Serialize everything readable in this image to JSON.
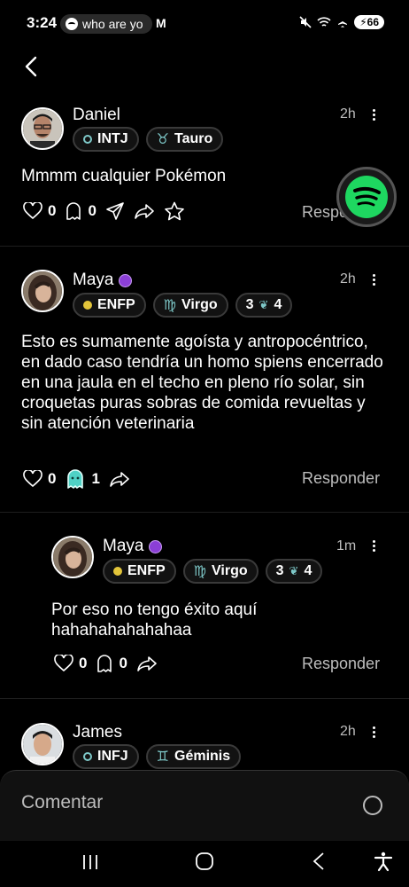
{
  "status": {
    "time": "3:24",
    "media_pill": "who are yo",
    "mail_glyph": "M",
    "battery": "66"
  },
  "comments": [
    {
      "name": "Daniel",
      "time": "2h",
      "badges": [
        {
          "label": "INTJ",
          "dot": "#7ec8c8"
        },
        {
          "label": "Tauro",
          "sign": "♉"
        }
      ],
      "text": "Mmmm cualquier Pokémon",
      "likes": "0",
      "ghosts": "0",
      "reply": "Responder"
    },
    {
      "name": "Maya",
      "time": "2h",
      "badges": [
        {
          "label": "ENFP",
          "dot": "#e3c53a"
        },
        {
          "label": "Virgo",
          "sign": "♍"
        },
        {
          "label": "3",
          "extra": "4"
        }
      ],
      "text": "Esto es sumamente agoísta y antropocéntrico, en dado caso tendría un homo spiens encerrado en una jaula en el techo en pleno  río solar, sin croquetas puras sobras de comida revueltas y sin atención veterinaria",
      "likes": "0",
      "ghosts": "1",
      "reply": "Responder"
    },
    {
      "name": "Maya",
      "time": "1m",
      "badges": [
        {
          "label": "ENFP",
          "dot": "#e3c53a"
        },
        {
          "label": "Virgo",
          "sign": "♍"
        },
        {
          "label": "3",
          "extra": "4"
        }
      ],
      "text": "Por eso no tengo éxito aquí hahahahahahahaa",
      "likes": "0",
      "ghosts": "0",
      "reply": "Responder"
    },
    {
      "name": "James",
      "time": "2h",
      "badges": [
        {
          "label": "INFJ",
          "dot": "#7ec8c8"
        },
        {
          "label": "Géminis",
          "sign": "♊"
        }
      ]
    }
  ],
  "composer": {
    "placeholder": "Comentar"
  },
  "colors": {
    "accent_ghost": "#4fd1c5",
    "spotify": "#1ed760",
    "premium_badge": "#8b3fd6"
  }
}
